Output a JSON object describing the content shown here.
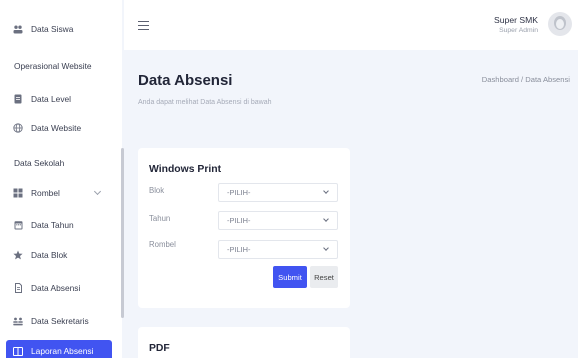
{
  "sidebar": {
    "items": [
      {
        "label": "Data Siswa"
      },
      {
        "label": "Data Level"
      },
      {
        "label": "Data Website"
      },
      {
        "label": "Rombel"
      },
      {
        "label": "Data Tahun"
      },
      {
        "label": "Data Blok"
      },
      {
        "label": "Data Absensi"
      },
      {
        "label": "Data Sekretaris"
      },
      {
        "label": "Laporan Absensi"
      }
    ],
    "sections": [
      "Operasional Website",
      "Data Sekolah"
    ]
  },
  "header": {
    "user_name": "Super SMK",
    "user_role": "Super Admin"
  },
  "main": {
    "title": "Data Absensi",
    "subtitle": "Anda dapat melihat Data Absensi di bawah",
    "breadcrumb": "Dashboard / Data Absensi",
    "card1": {
      "title": "Windows Print",
      "fields": [
        {
          "label": "Blok",
          "value": "-PILIH-"
        },
        {
          "label": "Tahun",
          "value": "-PILIH-"
        },
        {
          "label": "Rombel",
          "value": "-PILIH-"
        }
      ],
      "submit": "Submit",
      "reset": "Reset"
    },
    "card2": {
      "title": "PDF"
    }
  },
  "colors": {
    "accent": "#4154f1",
    "background": "#f2f5fb"
  }
}
